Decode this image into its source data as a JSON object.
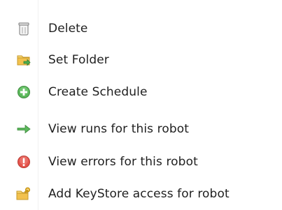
{
  "context_menu": {
    "items": [
      {
        "label": "Delete",
        "icon": "trash-can-icon"
      },
      {
        "label": "Set Folder",
        "icon": "folder-move-icon"
      },
      {
        "label": "Create Schedule",
        "icon": "green-plus-circle-icon"
      },
      {
        "label": "View runs for this robot",
        "icon": "green-arrow-right-icon"
      },
      {
        "label": "View errors for this robot",
        "icon": "red-exclamation-circle-icon"
      },
      {
        "label": "Add KeyStore access for robot",
        "icon": "folder-key-icon"
      }
    ],
    "colors": {
      "green": "#4caf50",
      "red": "#e53935",
      "folder_yellow": "#f2c14e"
    }
  }
}
